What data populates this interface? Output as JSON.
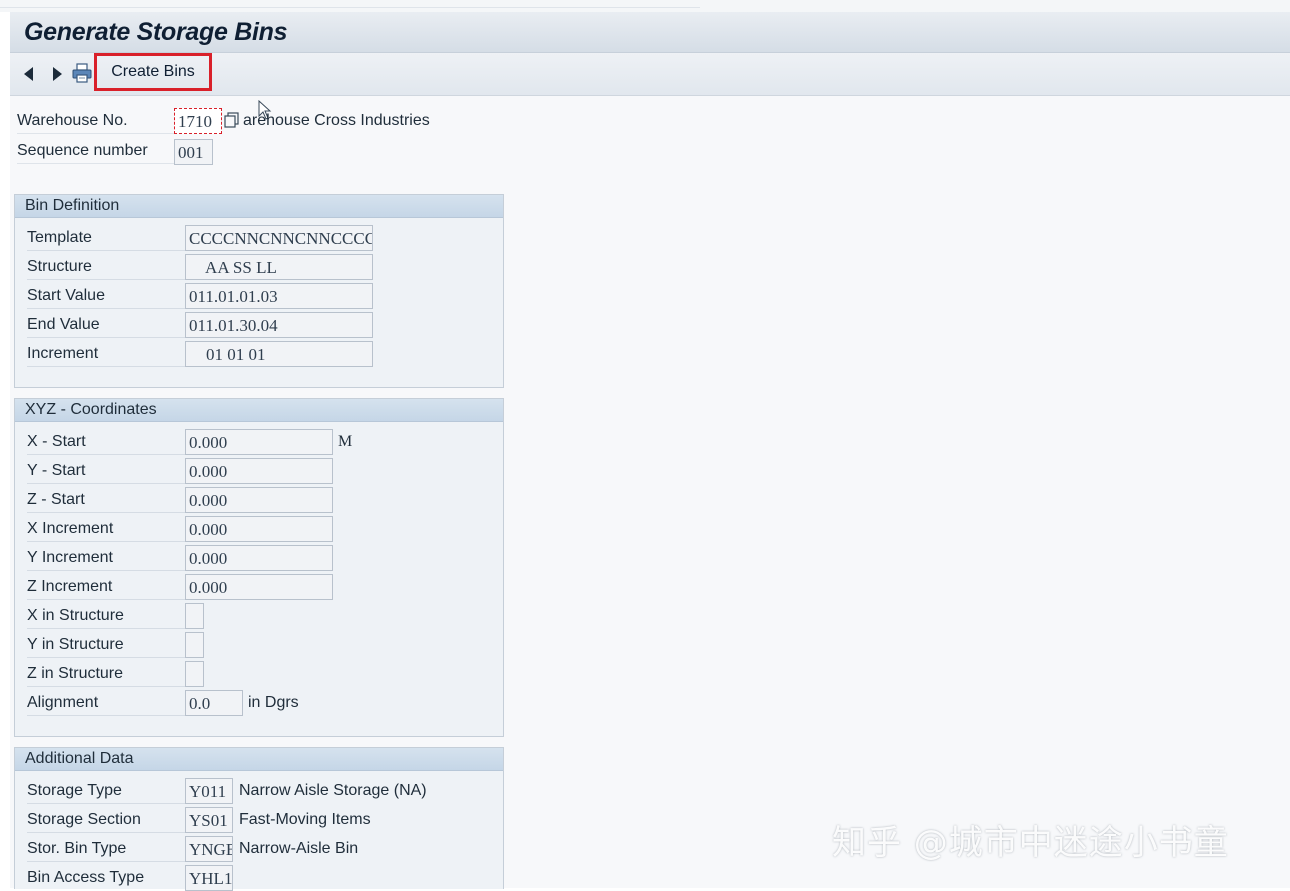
{
  "title": "Generate Storage Bins",
  "toolbar": {
    "back_icon": "back-arrow-icon",
    "forward_icon": "forward-arrow-icon",
    "print_icon": "printer-icon",
    "create_bins_label": "Create Bins",
    "highlight_color": "#d9202a"
  },
  "header": {
    "warehouse_label": "Warehouse No.",
    "warehouse_value": "1710",
    "warehouse_desc": "arehouse Cross Industries",
    "sequence_label": "Sequence number",
    "sequence_value": "001"
  },
  "bin_definition": {
    "title": "Bin Definition",
    "template_label": "Template",
    "template_value": "CCCCNNCNNCNNCCCCCC",
    "structure_label": "Structure",
    "structure_value": "    AA SS LL",
    "start_label": "Start Value",
    "start_value": "011.01.01.03",
    "end_label": "End Value",
    "end_value": "011.01.30.04",
    "increment_label": "Increment",
    "increment_value": "    01 01 01"
  },
  "xyz": {
    "title": "XYZ - Coordinates",
    "x_start_label": "X - Start",
    "x_start_value": "0.000",
    "x_unit": "M",
    "y_start_label": "Y - Start",
    "y_start_value": "0.000",
    "z_start_label": "Z - Start",
    "z_start_value": "0.000",
    "x_inc_label": "X Increment",
    "x_inc_value": "0.000",
    "y_inc_label": "Y Increment",
    "y_inc_value": "0.000",
    "z_inc_label": "Z Increment",
    "z_inc_value": "0.000",
    "x_struct_label": "X in Structure",
    "y_struct_label": "Y in Structure",
    "z_struct_label": "Z in Structure",
    "alignment_label": "Alignment",
    "alignment_value": "0.0",
    "alignment_unit": "in Dgrs"
  },
  "additional": {
    "title": "Additional Data",
    "storage_type_label": "Storage Type",
    "storage_type_value": "Y011",
    "storage_type_desc": "Narrow Aisle Storage (NA)",
    "storage_section_label": "Storage Section",
    "storage_section_value": "YS01",
    "storage_section_desc": "Fast-Moving Items",
    "bin_type_label": "Stor. Bin Type",
    "bin_type_value": "YNGB",
    "bin_type_desc": "Narrow-Aisle Bin",
    "bin_access_label": "Bin Access Type",
    "bin_access_value": "YHL1"
  },
  "watermark": "知乎 @城市中迷途小书童"
}
